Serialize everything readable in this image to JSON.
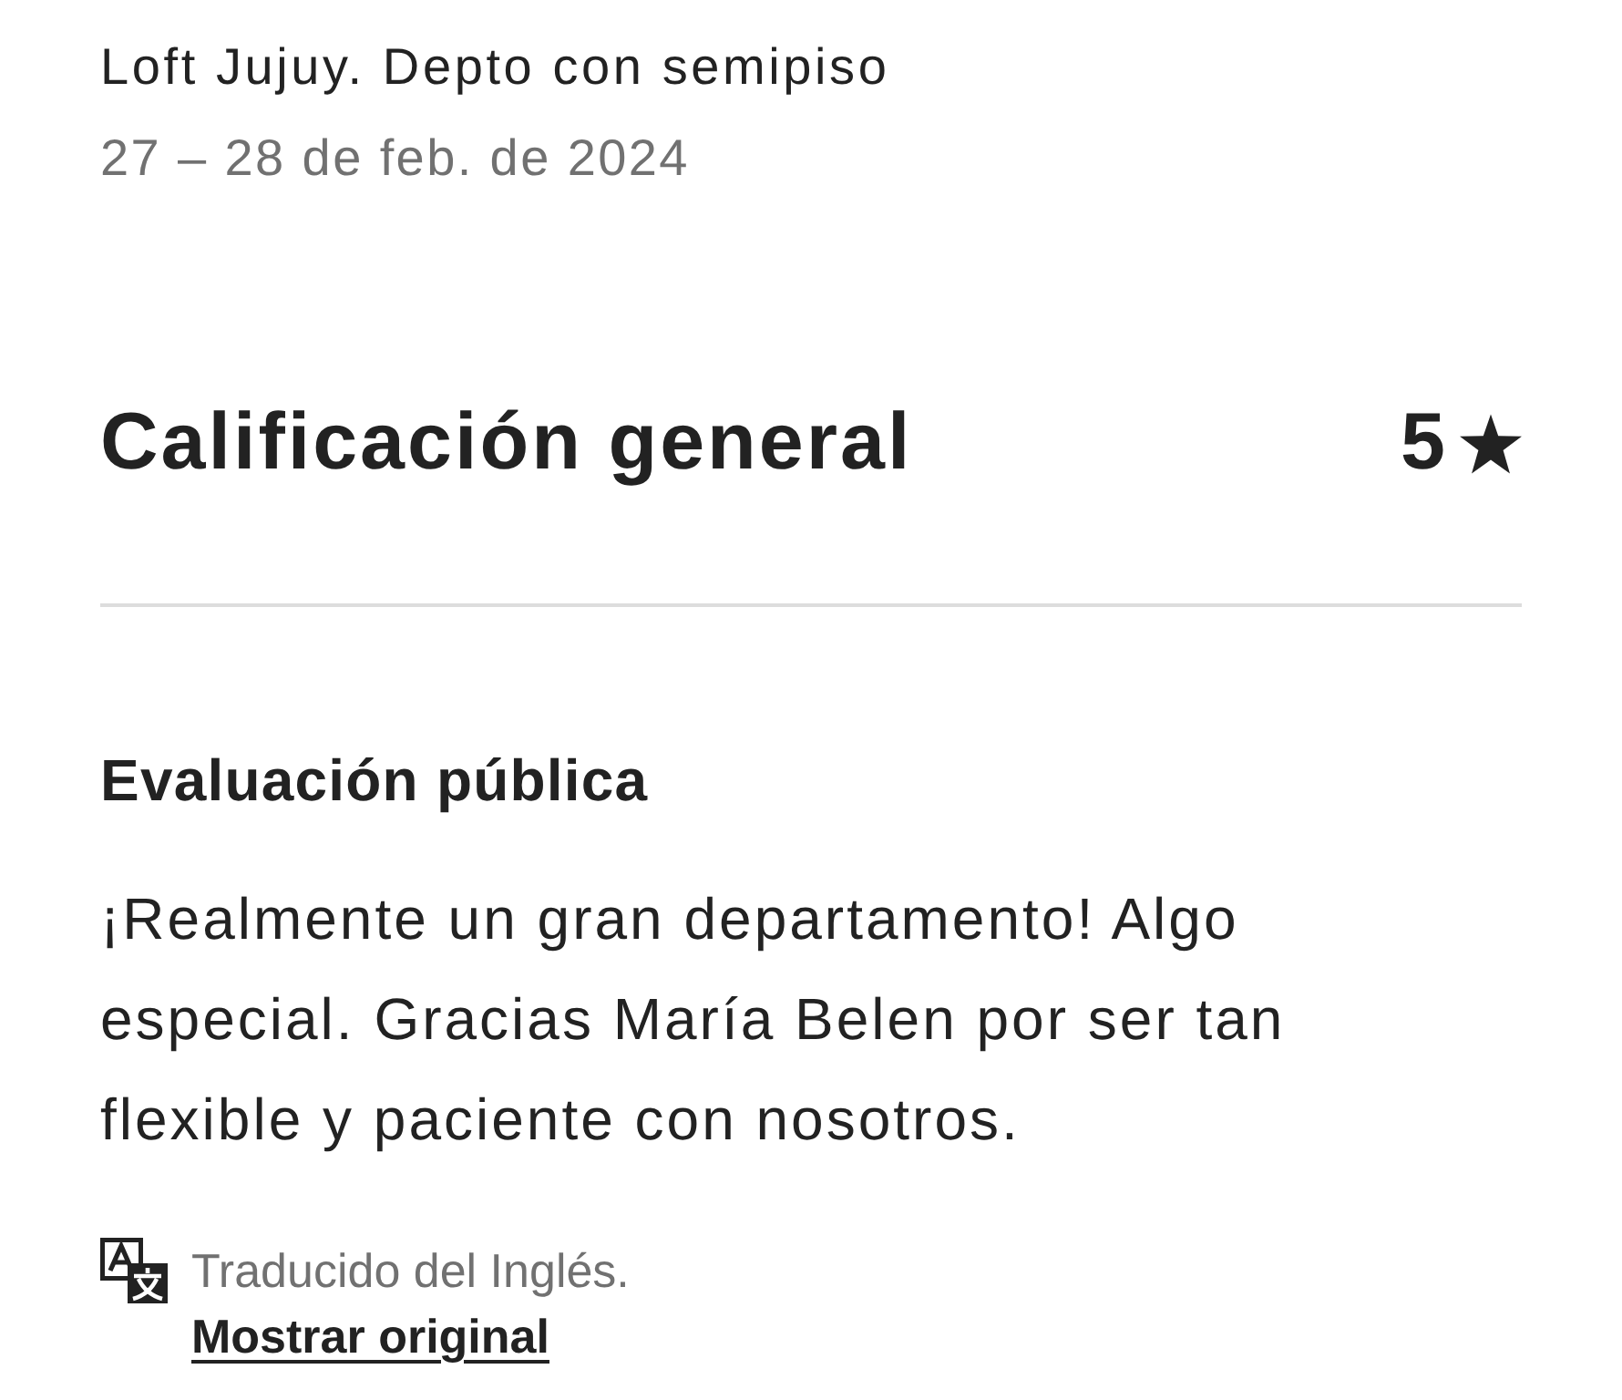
{
  "listing": {
    "title": "Loft Jujuy. Depto con semipiso",
    "dates": "27 – 28 de feb. de 2024"
  },
  "overall_rating": {
    "label": "Calificación general",
    "value": "5"
  },
  "public_review": {
    "heading": "Evaluación pública",
    "text": "¡Realmente un gran departamento! Algo especial. Gracias María Belen por ser tan flexible y paciente con nosotros.",
    "translation_note": "Traducido del Inglés.",
    "show_original_link": "Mostrar original"
  }
}
